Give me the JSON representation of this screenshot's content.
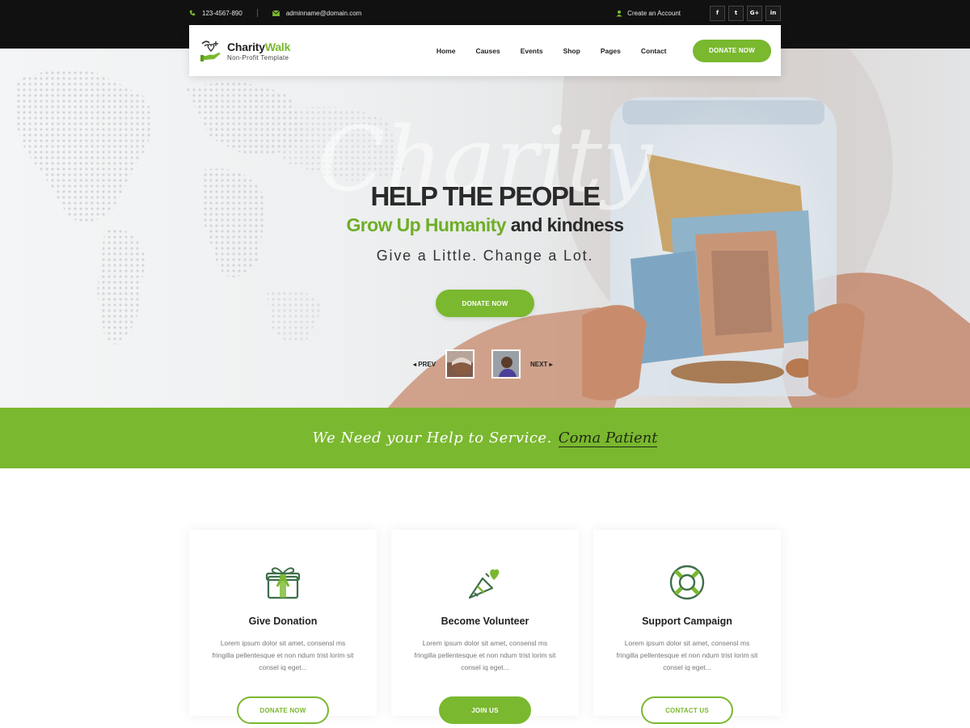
{
  "topbar": {
    "phone": "123-4567-890",
    "email": "adminname@domain.com",
    "account": "Create an Account",
    "social": [
      {
        "icon": "facebook-icon",
        "label": "f"
      },
      {
        "icon": "twitter-icon",
        "label": "t"
      },
      {
        "icon": "google-plus-icon",
        "label": "G+"
      },
      {
        "icon": "linkedin-icon",
        "label": "in"
      }
    ]
  },
  "header": {
    "logo_name_part1": "Charity",
    "logo_name_part2": "Walk",
    "logo_tagline": "Non-Profit Template",
    "nav": [
      "Home",
      "Causes",
      "Events",
      "Shop",
      "Pages",
      "Contact"
    ],
    "donate_label": "DONATE NOW"
  },
  "hero": {
    "watermark": "Charity",
    "title": "HELP THE PEOPLE",
    "subtitle_green": "Grow Up Humanity",
    "subtitle_rest": "and kindness",
    "tagline": "Give a Little. Change a Lot.",
    "button": "DONATE NOW",
    "prev_label": "PREV",
    "next_label": "NEXT"
  },
  "banner": {
    "text": "We Need your Help to Service.",
    "link": "Coma Patient"
  },
  "cards": [
    {
      "icon": "gift-icon",
      "title": "Give Donation",
      "text": "Lorem ipsum dolor sit amet, consensl ms fringilla pellentesque et non ndum trist lorim sit consel iq eget...",
      "button": "DONATE NOW"
    },
    {
      "icon": "megaphone-heart-icon",
      "title": "Become Volunteer",
      "text": "Lorem ipsum dolor sit amet, consensl ms fringilla pellentesque et non ndum trist lorim sit consel iq eget...",
      "button": "JOIN US"
    },
    {
      "icon": "lifebuoy-icon",
      "title": "Support Campaign",
      "text": "Lorem ipsum dolor sit amet, consensl ms fringilla pellentesque et non ndum trist lorim sit consel iq eget...",
      "button": "CONTACT US"
    }
  ],
  "colors": {
    "accent": "#7ab82f",
    "dark": "#111111",
    "text": "#222222"
  }
}
